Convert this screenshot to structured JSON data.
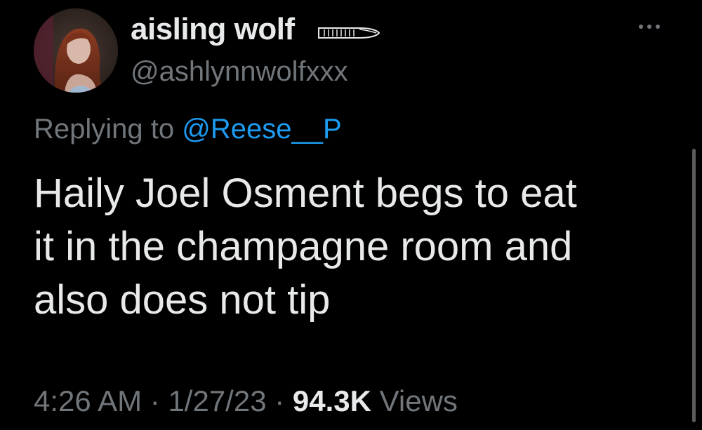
{
  "author": {
    "display_name": "aisling wolf",
    "handle": "@ashlynnwolfxxx",
    "avatar_icon": "profile-photo",
    "badge_icon": "wing-icon"
  },
  "reply": {
    "prefix": "Replying to ",
    "mention": "@Reese__P"
  },
  "tweet": {
    "lines": [
      "Haily Joel Osment begs to eat",
      "it in the champagne room and",
      "also does not tip"
    ]
  },
  "meta": {
    "time": "4:26 AM",
    "separator": " · ",
    "date": "1/27/23",
    "views_count": "94.3K",
    "views_label": " Views"
  },
  "colors": {
    "background": "#000000",
    "primary_text": "#e7e9ea",
    "secondary_text": "#71767b",
    "link": "#1d9bf0"
  }
}
